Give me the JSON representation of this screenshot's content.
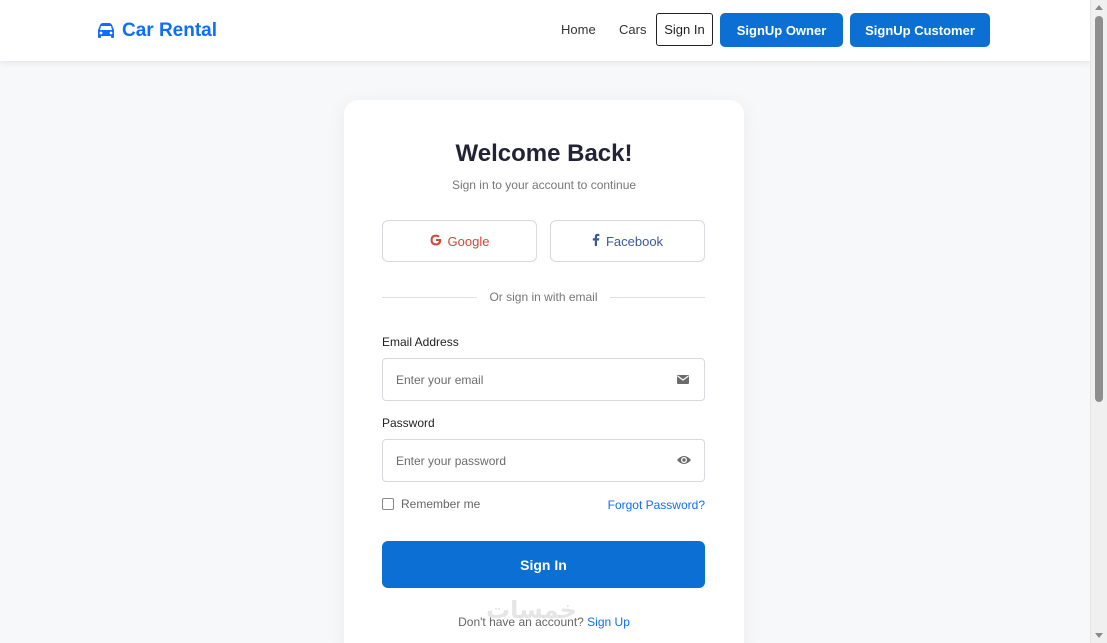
{
  "brand": {
    "name": "Car Rental",
    "icon": "car-icon",
    "color": "#0d6efd"
  },
  "nav": {
    "home": "Home",
    "cars": "Cars",
    "signin": "Sign In",
    "signup_owner": "SignUp Owner",
    "signup_customer": "SignUp Customer"
  },
  "form": {
    "title": "Welcome Back!",
    "subtitle": "Sign in to your account to continue",
    "google": "Google",
    "facebook": "Facebook",
    "divider": "Or sign in with email",
    "email_label": "Email Address",
    "email_placeholder": "Enter your email",
    "email_icon": "envelope-icon",
    "password_label": "Password",
    "password_placeholder": "Enter your password",
    "password_icon": "eye-icon",
    "remember": "Remember me",
    "forgot": "Forgot Password?",
    "submit": "Sign In",
    "no_account": "Don't have an account?",
    "signup": "Sign Up"
  },
  "watermark": "خمسات",
  "colors": {
    "primary": "#0b6fd4",
    "google": "#d9443b",
    "facebook": "#3b5998",
    "background": "#f7f8fa"
  }
}
